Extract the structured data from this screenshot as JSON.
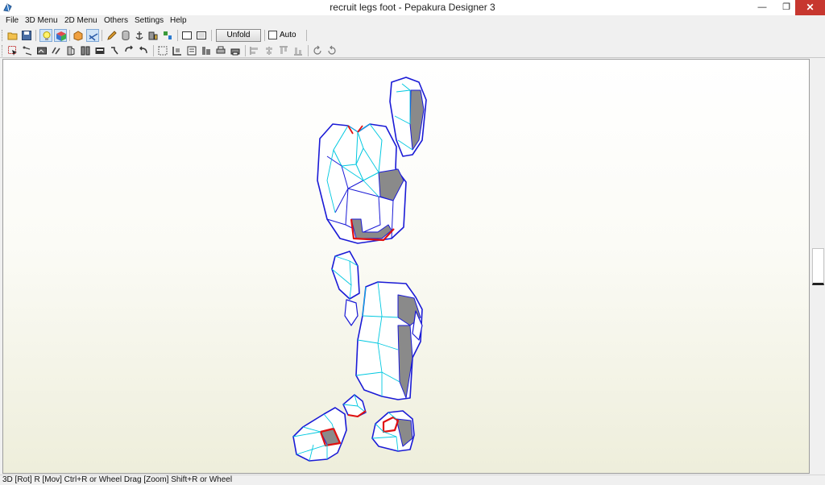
{
  "window": {
    "title": "recruit legs foot - Pepakura Designer 3",
    "minimize_glyph": "—",
    "maximize_glyph": "❐",
    "close_glyph": "✕"
  },
  "menu": [
    {
      "label": "File"
    },
    {
      "label": "3D Menu"
    },
    {
      "label": "2D Menu"
    },
    {
      "label": "Others"
    },
    {
      "label": "Settings"
    },
    {
      "label": "Help"
    }
  ],
  "toolbar": {
    "unfold_label": "Unfold",
    "auto_label": "Auto",
    "auto_checked": false
  },
  "status": {
    "text": "3D [Rot] R [Mov] Ctrl+R or Wheel Drag [Zoom] Shift+R or Wheel"
  },
  "colors": {
    "edge_blue": "#1a1ad6",
    "edge_cyan": "#00c8e0",
    "cut_red": "#e01010",
    "face_gray": "#8a8a8a",
    "close_red": "#c7372f"
  },
  "icons": [
    "pepakura-app-icon",
    "open-folder-icon",
    "save-icon",
    "lightbulb-icon",
    "texture-cube-icon",
    "edit-icon"
  ]
}
